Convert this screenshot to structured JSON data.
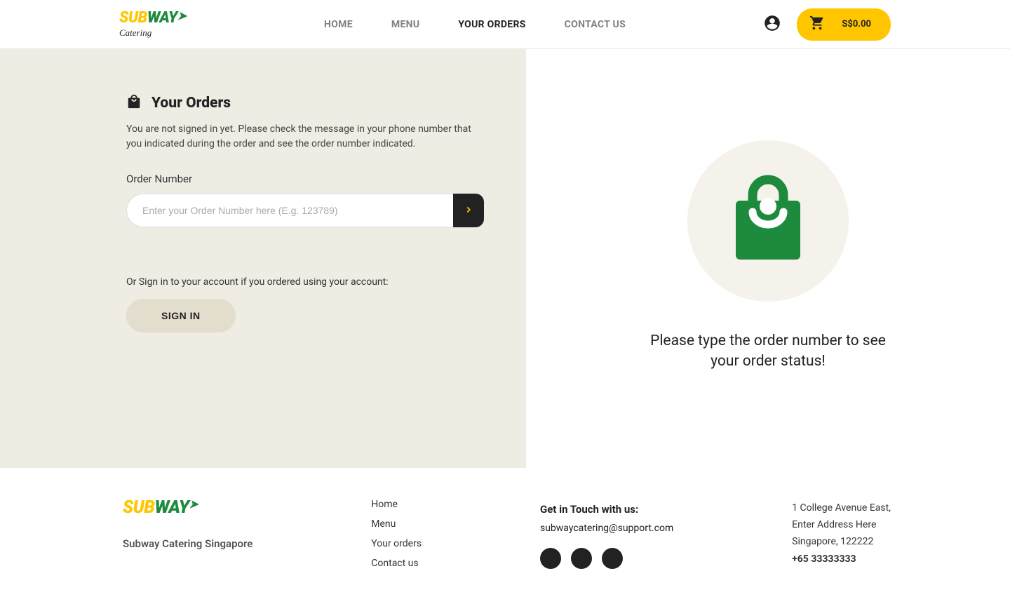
{
  "brand": {
    "name_part1": "SUB",
    "name_part2": "WAY",
    "catering_label": "Catering"
  },
  "nav": {
    "home": "HOME",
    "menu": "MENU",
    "orders": "YOUR ORDERS",
    "contact": "CONTACT US"
  },
  "cart": {
    "amount": "S$0.00"
  },
  "orders_panel": {
    "title": "Your Orders",
    "desc": "You are not signed in yet. Please check the message in your phone number that you indicated during the order and see the order number indicated.",
    "input_label": "Order Number",
    "placeholder": "Enter your Order Number here (E.g. 123789)",
    "or_text": "Or Sign in to your account if you ordered using your account:",
    "signin_label": "SIGN IN"
  },
  "right": {
    "message": "Please type the order number to see your order status!"
  },
  "footer": {
    "tagline": "Subway Catering Singapore",
    "links": {
      "home": "Home",
      "menu": "Menu",
      "orders": "Your orders",
      "contact": "Contact us"
    },
    "contact_title": "Get in Touch with us:",
    "email": "subwaycatering@support.com",
    "addr1": "1 College Avenue East,",
    "addr2": "Enter Address Here",
    "addr3": "Singapore, 122222",
    "phone": "+65 33333333"
  }
}
